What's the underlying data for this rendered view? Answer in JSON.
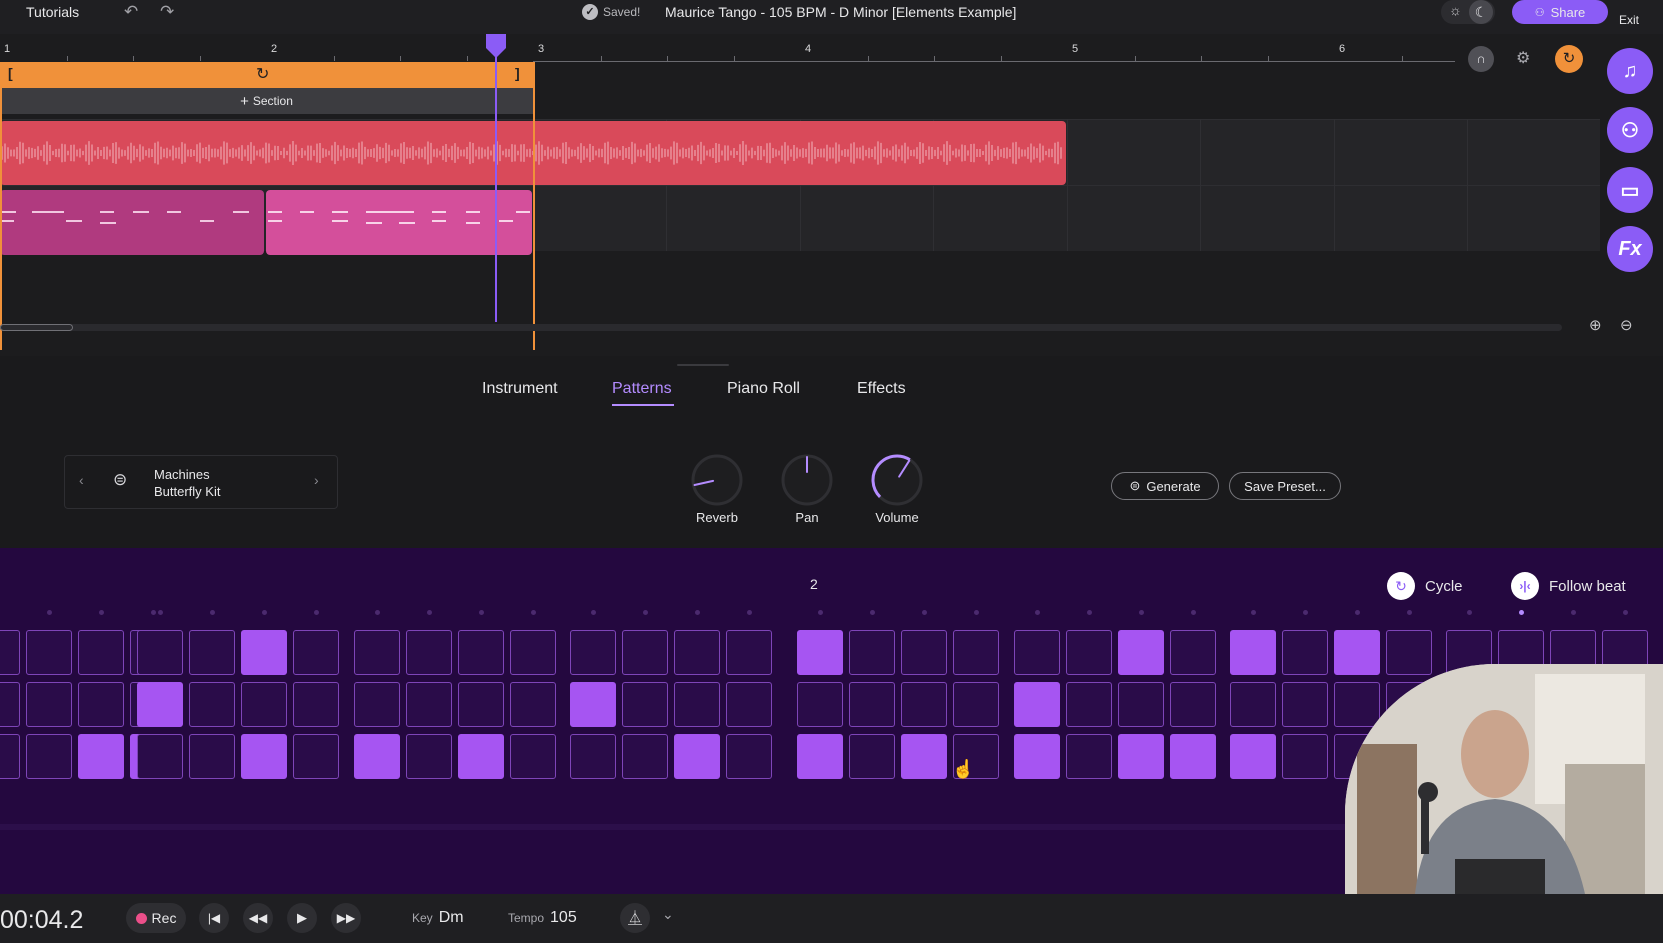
{
  "topbar": {
    "tutorials": "Tutorials",
    "saved": "Saved!",
    "title": "Maurice Tango - 105 BPM - D Minor [Elements Example]",
    "share": "Share",
    "exit": "Exit"
  },
  "timeline": {
    "bars": [
      "1",
      "2",
      "3",
      "4",
      "5",
      "6"
    ],
    "section_label": "Section"
  },
  "tabs": {
    "instrument": "Instrument",
    "patterns": "Patterns",
    "piano_roll": "Piano Roll",
    "effects": "Effects"
  },
  "instrument": {
    "category": "Machines",
    "kit": "Butterfly Kit",
    "knobs": [
      {
        "label": "Reverb",
        "value": 0.12
      },
      {
        "label": "Pan",
        "value": 0.5
      },
      {
        "label": "Volume",
        "value": 0.62
      }
    ],
    "generate": "Generate",
    "save_preset": "Save Preset..."
  },
  "pattern": {
    "bar_label": "2",
    "cycle": "Cycle",
    "follow_beat": "Follow beat",
    "rows": [
      [
        0,
        0,
        0,
        0,
        0,
        1,
        0,
        0,
        0,
        0,
        0,
        0,
        0,
        0,
        0,
        1,
        0,
        0,
        0,
        0,
        0,
        1,
        0,
        1,
        0,
        1,
        0,
        0,
        0,
        0,
        0
      ],
      [
        0,
        0,
        0,
        1,
        0,
        0,
        0,
        0,
        0,
        0,
        0,
        1,
        0,
        0,
        0,
        0,
        0,
        0,
        0,
        1,
        0,
        0,
        0,
        0,
        0,
        0,
        0,
        0,
        0,
        0,
        0
      ],
      [
        0,
        1,
        1,
        0,
        0,
        1,
        0,
        1,
        0,
        1,
        0,
        0,
        0,
        1,
        0,
        1,
        0,
        1,
        0,
        1,
        0,
        1,
        1,
        1,
        0,
        0,
        0,
        0,
        0,
        0,
        0
      ]
    ]
  },
  "transport": {
    "time": "00:04.2",
    "rec": "Rec",
    "key_label": "Key",
    "key_value": "Dm",
    "tempo_label": "Tempo",
    "tempo_value": "105"
  },
  "colors": {
    "accent": "#8b5cf6",
    "loop_region": "#f0913a",
    "audio_clip": "#d94a5a",
    "midi_clip": "#c4478f",
    "pattern_bg": "#24083f",
    "pattern_on": "#a655f2"
  }
}
